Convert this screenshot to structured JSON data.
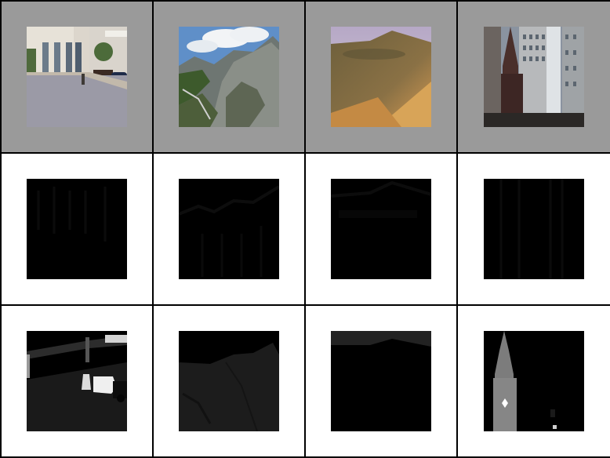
{
  "rows": [
    {
      "label": "input-images",
      "background": "#9a9a9a"
    },
    {
      "label": "feature-maps",
      "background": "#ffffff"
    },
    {
      "label": "segmentation-masks",
      "background": "#ffffff"
    }
  ],
  "columns": [
    "street",
    "mountain",
    "desert",
    "city-church"
  ]
}
